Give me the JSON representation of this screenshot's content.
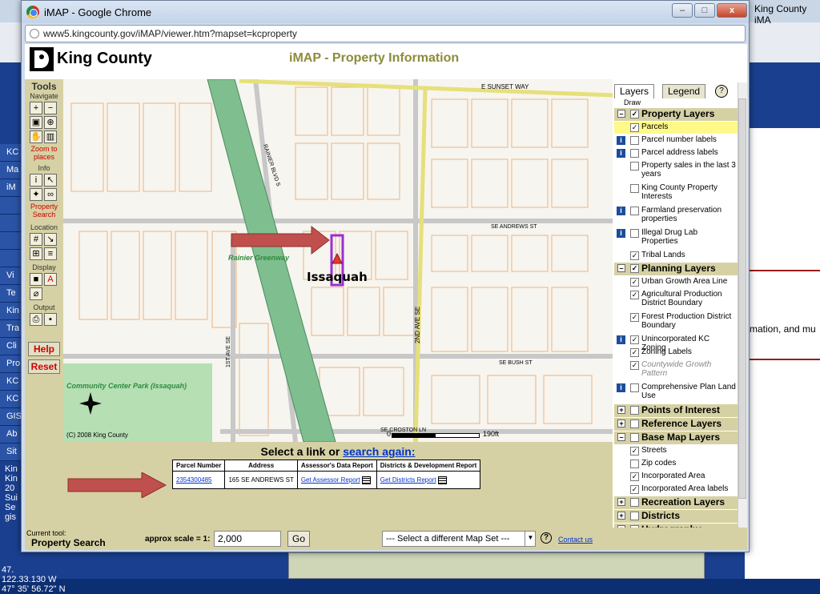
{
  "background": {
    "right_tab_title": "King County iMA",
    "right_text": "rmation, and mu",
    "left_items": [
      "KC",
      "Ma",
      "iM",
      "",
      "",
      "",
      "",
      "Vi",
      "Te",
      "Kin",
      "Tra",
      "Cli",
      "Pro",
      "KC",
      "KC",
      "GIS",
      "Ab",
      "Sit"
    ],
    "left_text_block": [
      "Kin",
      "Kin",
      "20",
      "Sui",
      "Se",
      "gis"
    ],
    "coord_1": "47.",
    "coord_2": "122.33.130 W",
    "coord_3": "47° 35' 56.72\" N"
  },
  "window": {
    "title": "iMAP - Google Chrome",
    "url": "www5.kingcounty.gov/iMAP/viewer.htm?mapset=kcproperty",
    "min": "–",
    "max": "□",
    "close": "x"
  },
  "header": {
    "logo_text": "King County",
    "title": "iMAP - Property Information"
  },
  "tools": {
    "title": "Tools",
    "navigate": "Navigate",
    "zoom_to_places": "Zoom to places",
    "info": "Info",
    "property_search": "Property Search",
    "location": "Location",
    "display": "Display",
    "output": "Output",
    "help": "Help",
    "reset": "Reset"
  },
  "map": {
    "streets": {
      "sunset": "E SUNSET WAY",
      "rainier": "RAINIER BLVD S",
      "andrews": "SE ANDREWS ST",
      "bush": "SE BUSH ST",
      "croston": "SE CROSTON LN",
      "second_ave": "2ND AVE SE",
      "first_ave": "1ST AVE SE"
    },
    "greenway": "Rainier Greenway",
    "city": "Issaquah",
    "park": "Community Center Park (Issaquah)",
    "copyright": "(C) 2008 King County",
    "scale_zero": "0",
    "scale_label": "190ft"
  },
  "results": {
    "heading_prefix": "Select a link or ",
    "heading_link": "search again:",
    "columns": [
      "Parcel Number",
      "Address",
      "Assessor's Data Report",
      "Districts & Development Report"
    ],
    "row": {
      "parcel": "2354300485",
      "address": "165 SE ANDREWS ST",
      "assessor": "Get Assessor Report",
      "districts": "Get Districts Report"
    }
  },
  "bottom": {
    "current_tool_label": "Current tool:",
    "current_tool": "Property Search",
    "scale_label": "approx scale = 1:",
    "scale_value": "2,000",
    "go": "Go",
    "mapset": "--- Select a different Map Set ---",
    "help": "?",
    "contact": "Contact us"
  },
  "layers": {
    "tab_layers": "Layers",
    "tab_legend": "Legend",
    "help": "?",
    "draw": "Draw",
    "rows": [
      {
        "type": "group",
        "label": "Property Layers",
        "pm": "–",
        "checked": "✓"
      },
      {
        "type": "item",
        "label": "Parcels",
        "checked": "✓",
        "info": false,
        "hl": true
      },
      {
        "type": "item",
        "label": "Parcel number labels",
        "checked": "",
        "info": true
      },
      {
        "type": "item",
        "label": "Parcel address labels",
        "checked": "",
        "info": true
      },
      {
        "type": "item",
        "label": "Property sales in the last 3 years",
        "checked": "",
        "info": false
      },
      {
        "type": "item",
        "label": "King County Property Interests",
        "checked": "",
        "info": false
      },
      {
        "type": "item",
        "label": "Farmland preservation properties",
        "checked": "",
        "info": true
      },
      {
        "type": "item",
        "label": "Illegal Drug Lab Properties",
        "checked": "",
        "info": true
      },
      {
        "type": "item",
        "label": "Tribal Lands",
        "checked": "✓",
        "info": false
      },
      {
        "type": "group",
        "label": "Planning Layers",
        "pm": "–",
        "checked": "✓"
      },
      {
        "type": "item",
        "label": "Urban Growth Area Line",
        "checked": "✓",
        "info": false
      },
      {
        "type": "item",
        "label": "Agricultural Production District Boundary",
        "checked": "✓",
        "info": false
      },
      {
        "type": "item",
        "label": "Forest Production District Boundary",
        "checked": "✓",
        "info": false
      },
      {
        "type": "item",
        "label": "Unincorporated KC Zoning",
        "checked": "✓",
        "info": true
      },
      {
        "type": "item",
        "label": "Zoning Labels",
        "checked": "✓",
        "info": false
      },
      {
        "type": "item",
        "label": "Countywide Growth Pattern",
        "checked": "✓",
        "info": false,
        "dim": true
      },
      {
        "type": "item",
        "label": "Comprehensive Plan Land Use",
        "checked": "",
        "info": true
      },
      {
        "type": "group",
        "label": "Points of Interest",
        "pm": "+",
        "checked": ""
      },
      {
        "type": "group",
        "label": "Reference Layers",
        "pm": "+",
        "checked": ""
      },
      {
        "type": "group",
        "label": "Base Map Layers",
        "pm": "–",
        "checked": ""
      },
      {
        "type": "item",
        "label": "Streets",
        "checked": "✓",
        "info": false
      },
      {
        "type": "item",
        "label": "Zip codes",
        "checked": "",
        "info": false
      },
      {
        "type": "item",
        "label": "Incorporated Area",
        "checked": "✓",
        "info": false
      },
      {
        "type": "item",
        "label": "Incorporated Area labels",
        "checked": "✓",
        "info": false
      },
      {
        "type": "group",
        "label": "Recreation Layers",
        "pm": "+",
        "checked": ""
      },
      {
        "type": "group",
        "label": "Districts",
        "pm": "+",
        "checked": ""
      },
      {
        "type": "group",
        "label": "Hydrography",
        "pm": "+",
        "checked": ""
      }
    ]
  },
  "colors": {
    "accent_olive": "#8c8c3a",
    "panel_khaki": "#d6d1a4",
    "link_blue": "#0033cc",
    "arrow_red": "#c0504d",
    "parcel_purple": "#9b30d0"
  }
}
